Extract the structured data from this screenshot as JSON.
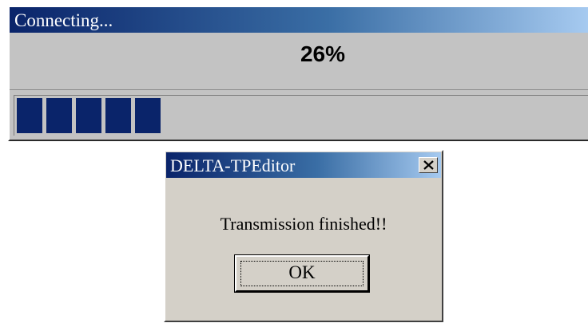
{
  "progress_window": {
    "title": "Connecting...",
    "percent_text": "26%",
    "progress_fraction": 0.26,
    "filled_blocks": 5,
    "colors": {
      "titlebar_start": "#0a246a",
      "titlebar_end": "#a6caf0",
      "bar_fill": "#0a246a",
      "face": "#c3c3c3"
    }
  },
  "dialog": {
    "title": "DELTA-TPEditor",
    "close_icon": "close-icon",
    "message": "Transmission finished!!",
    "ok_label": "OK",
    "colors": {
      "face": "#d4d0c8"
    }
  }
}
